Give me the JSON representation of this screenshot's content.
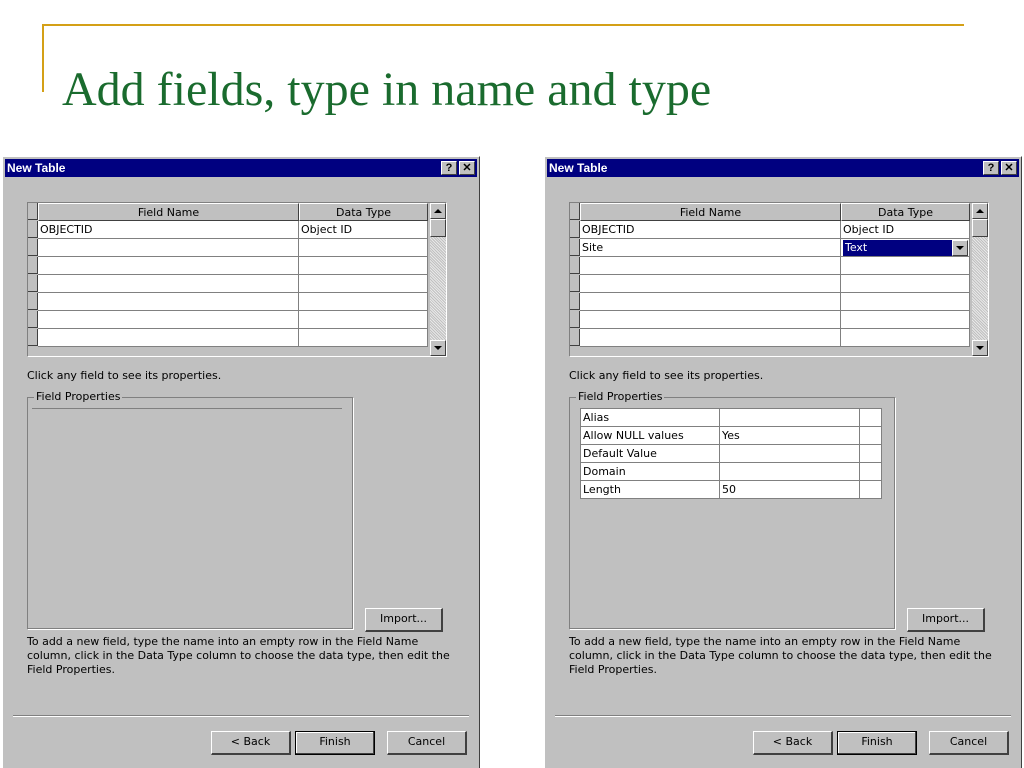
{
  "slide": {
    "title": "Add fields, type in name and type"
  },
  "dialogs": [
    {
      "window_title": "New Table",
      "help_label": "?",
      "close_label": "✕",
      "grid": {
        "headers": [
          "Field Name",
          "Data Type"
        ],
        "rows": [
          [
            "OBJECTID",
            "Object ID"
          ],
          [
            "",
            ""
          ],
          [
            "",
            ""
          ],
          [
            "",
            ""
          ],
          [
            "",
            ""
          ],
          [
            "",
            ""
          ],
          [
            "",
            ""
          ]
        ]
      },
      "hint": "Click any field to see its properties.",
      "group_title": "Field Properties",
      "properties": [],
      "import_label": "Import...",
      "instructions": "To add a new field, type the name into an empty row in the Field Name column, click in the Data Type column to choose the data type, then edit the Field Properties.",
      "back_label": "< Back",
      "finish_label": "Finish",
      "cancel_label": "Cancel"
    },
    {
      "window_title": "New Table",
      "help_label": "?",
      "close_label": "✕",
      "grid": {
        "headers": [
          "Field Name",
          "Data Type"
        ],
        "rows": [
          [
            "OBJECTID",
            "Object ID"
          ],
          [
            "Site",
            "Text"
          ],
          [
            "",
            ""
          ],
          [
            "",
            ""
          ],
          [
            "",
            ""
          ],
          [
            "",
            ""
          ],
          [
            "",
            ""
          ]
        ]
      },
      "hint": "Click any field to see its properties.",
      "group_title": "Field Properties",
      "properties": [
        [
          "Alias",
          ""
        ],
        [
          "Allow NULL values",
          "Yes"
        ],
        [
          "Default Value",
          ""
        ],
        [
          "Domain",
          ""
        ],
        [
          "Length",
          "50"
        ]
      ],
      "import_label": "Import...",
      "instructions": "To add a new field, type the name into an empty row in the Field Name column, click in the Data Type column to choose the data type, then edit the Field Properties.",
      "back_label": "< Back",
      "finish_label": "Finish",
      "cancel_label": "Cancel"
    }
  ],
  "colors": {
    "title_green": "#1a6b2e",
    "accent_gold": "#d4a017",
    "titlebar_blue": "#000080",
    "dialog_gray": "#c0c0c0"
  }
}
